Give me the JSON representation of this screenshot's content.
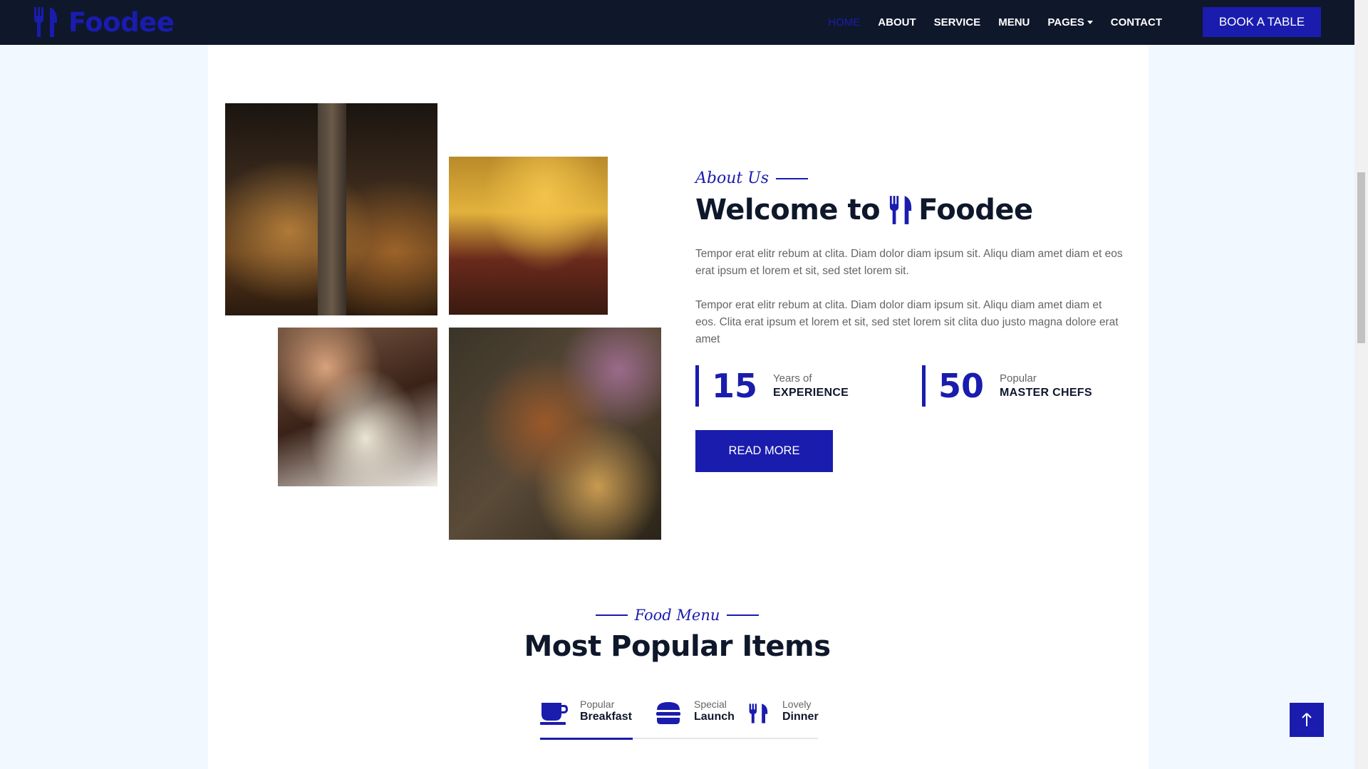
{
  "brand": {
    "name": "Foodee",
    "icon": "utensils-icon"
  },
  "nav": {
    "items": [
      {
        "label": "HOME",
        "active": true
      },
      {
        "label": "ABOUT"
      },
      {
        "label": "SERVICE"
      },
      {
        "label": "MENU"
      },
      {
        "label": "PAGES"
      },
      {
        "label": "CONTACT"
      }
    ],
    "cta": "BOOK A TABLE"
  },
  "about": {
    "eyebrow": "About Us",
    "title_prefix": "Welcome to",
    "title_brand": "Foodee",
    "paragraph1": "Tempor erat elitr rebum at clita. Diam dolor diam ipsum sit. Aliqu diam amet diam et eos erat ipsum et lorem et sit, sed stet lorem sit.",
    "paragraph2": "Tempor erat elitr rebum at clita. Diam dolor diam ipsum sit. Aliqu diam amet diam et eos. Clita erat ipsum et lorem et sit, sed stet lorem sit clita duo justo magna dolore erat amet",
    "stats": [
      {
        "number": "15",
        "small": "Years of",
        "big": "EXPERIENCE"
      },
      {
        "number": "50",
        "small": "Popular",
        "big": "MASTER CHEFS"
      }
    ],
    "button": "READ MORE"
  },
  "menu": {
    "eyebrow": "Food Menu",
    "title": "Most Popular Items",
    "tabs": [
      {
        "small": "Popular",
        "big": "Breakfast",
        "icon": "coffee-icon",
        "active": true
      },
      {
        "small": "Special",
        "big": "Launch",
        "icon": "hamburger-icon"
      },
      {
        "small": "Lovely",
        "big": "Dinner",
        "icon": "utensils-icon"
      }
    ]
  },
  "colors": {
    "primary": "#1a1cae",
    "dark": "#0f172b",
    "bg": "#f1f8ff"
  }
}
